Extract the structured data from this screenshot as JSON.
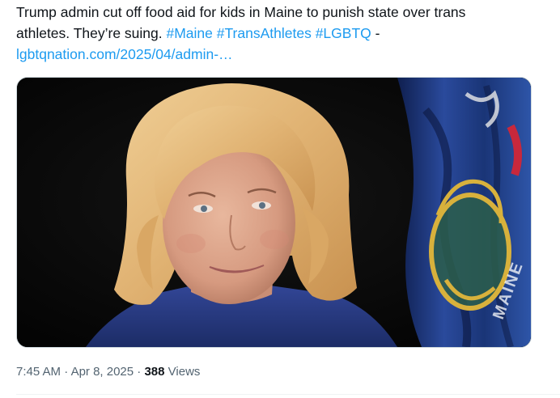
{
  "tweet": {
    "text_line1": "Trump admin cut off food aid for kids in Maine to punish state over trans",
    "text_line2_prefix": "athletes. They’re suing. ",
    "hashtags": [
      "#Maine",
      "#TransAthletes",
      "#LGBTQ"
    ],
    "separator": " -",
    "link_text": "lgbtqnation.com/2025/04/admin-…"
  },
  "media": {
    "flag_text": "MAINE",
    "colors": {
      "background": "#050505",
      "flag_blue": "#1f3e8a",
      "hair": "#e4b978",
      "skin": "#dca287",
      "jacket": "#2a3e86",
      "lips": "#b46d6a"
    }
  },
  "meta": {
    "time": "7:45 AM",
    "dot1": " · ",
    "date": "Apr 8, 2025",
    "dot2": " · ",
    "views_count": "388",
    "views_label": " Views"
  },
  "colors": {
    "text": "#0f1419",
    "link": "#1d9bf0",
    "muted": "#536471",
    "border": "#cfd9de"
  }
}
